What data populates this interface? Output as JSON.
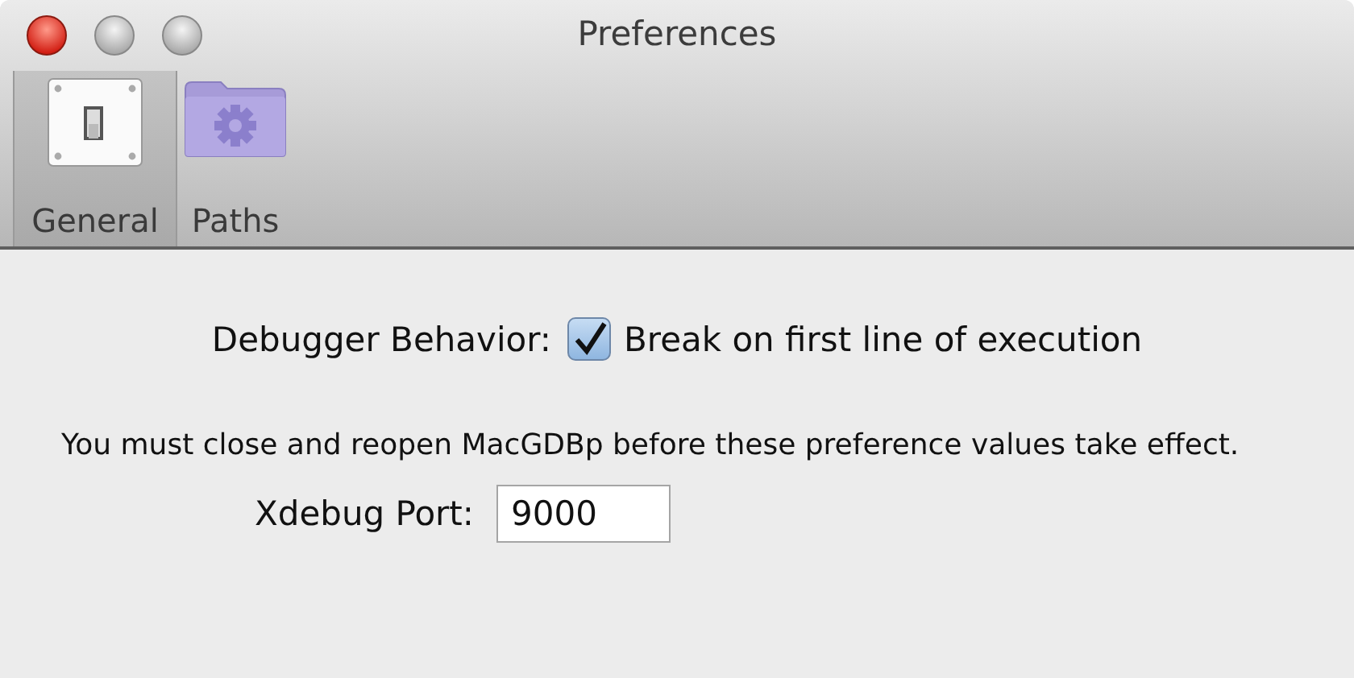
{
  "window": {
    "title": "Preferences"
  },
  "toolbar": [
    {
      "label": "General",
      "kind": "switch",
      "selected": true
    },
    {
      "label": "Paths",
      "kind": "folder",
      "selected": false
    }
  ],
  "debugger": {
    "label": "Debugger Behavior:",
    "option": "Break on first line of execution",
    "checked": true
  },
  "note": "You must close and reopen MacGDBp before these preference values take effect.",
  "port": {
    "label": "Xdebug Port:",
    "value": "9000"
  }
}
